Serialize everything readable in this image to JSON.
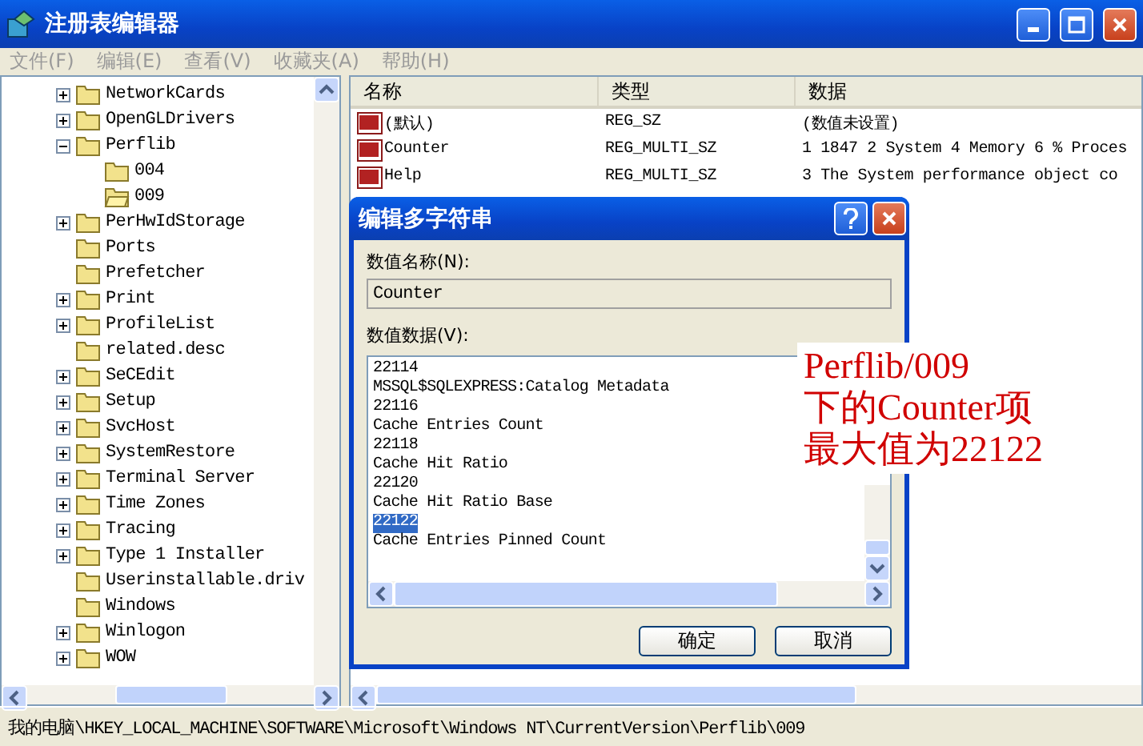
{
  "window": {
    "title": "注册表编辑器"
  },
  "menu": [
    "文件(F)",
    "编辑(E)",
    "查看(V)",
    "收藏夹(A)",
    "帮助(H)"
  ],
  "tree": [
    {
      "label": "NetworkCards",
      "expandable": true,
      "expanded": false,
      "selected": false
    },
    {
      "label": "OpenGLDrivers",
      "expandable": true,
      "expanded": false,
      "selected": false
    },
    {
      "label": "Perflib",
      "expandable": true,
      "expanded": true,
      "selected": false,
      "children": [
        {
          "label": "004",
          "expandable": false,
          "selected": false
        },
        {
          "label": "009",
          "expandable": false,
          "selected": true
        }
      ]
    },
    {
      "label": "PerHwIdStorage",
      "expandable": true,
      "expanded": false,
      "selected": false
    },
    {
      "label": "Ports",
      "expandable": false,
      "selected": false
    },
    {
      "label": "Prefetcher",
      "expandable": false,
      "selected": false
    },
    {
      "label": "Print",
      "expandable": true,
      "expanded": false,
      "selected": false
    },
    {
      "label": "ProfileList",
      "expandable": true,
      "expanded": false,
      "selected": false
    },
    {
      "label": "related.desc",
      "expandable": false,
      "selected": false
    },
    {
      "label": "SeCEdit",
      "expandable": true,
      "expanded": false,
      "selected": false
    },
    {
      "label": "Setup",
      "expandable": true,
      "expanded": false,
      "selected": false
    },
    {
      "label": "SvcHost",
      "expandable": true,
      "expanded": false,
      "selected": false
    },
    {
      "label": "SystemRestore",
      "expandable": true,
      "expanded": false,
      "selected": false
    },
    {
      "label": "Terminal Server",
      "expandable": true,
      "expanded": false,
      "selected": false
    },
    {
      "label": "Time Zones",
      "expandable": true,
      "expanded": false,
      "selected": false
    },
    {
      "label": "Tracing",
      "expandable": true,
      "expanded": false,
      "selected": false
    },
    {
      "label": "Type 1 Installer",
      "expandable": true,
      "expanded": false,
      "selected": false
    },
    {
      "label": "Userinstallable.driv",
      "expandable": false,
      "selected": false
    },
    {
      "label": "Windows",
      "expandable": false,
      "selected": false
    },
    {
      "label": "Winlogon",
      "expandable": true,
      "expanded": false,
      "selected": false
    },
    {
      "label": "WOW",
      "expandable": true,
      "expanded": false,
      "selected": false
    }
  ],
  "table": {
    "columns": [
      "名称",
      "类型",
      "数据"
    ],
    "rows": [
      {
        "name": "(默认)",
        "type": "REG_SZ",
        "data": "(数值未设置)"
      },
      {
        "name": "Counter",
        "type": "REG_MULTI_SZ",
        "data": "1 1847 2 System 4 Memory 6 % Proces"
      },
      {
        "name": "Help",
        "type": "REG_MULTI_SZ",
        "data": "3 The System performance object co"
      }
    ]
  },
  "dialog": {
    "title": "编辑多字符串",
    "name_label": "数值名称(N):",
    "name_value": "Counter",
    "data_label": "数值数据(V):",
    "lines": [
      {
        "text": "22114",
        "selected": false
      },
      {
        "text": "MSSQL$SQLEXPRESS:Catalog Metadata",
        "selected": false
      },
      {
        "text": "22116",
        "selected": false
      },
      {
        "text": "Cache Entries Count",
        "selected": false
      },
      {
        "text": "22118",
        "selected": false
      },
      {
        "text": "Cache Hit Ratio",
        "selected": false
      },
      {
        "text": "22120",
        "selected": false
      },
      {
        "text": "Cache Hit Ratio Base",
        "selected": false
      },
      {
        "text": "22122",
        "selected": true
      },
      {
        "text": "Cache Entries Pinned Count",
        "selected": false
      }
    ],
    "buttons": [
      "确定",
      "取消"
    ]
  },
  "annotation": {
    "lines": [
      "Perflib/009",
      "下的Counter项",
      "最大值为22122"
    ]
  },
  "status_bar": "我的电脑\\HKEY_LOCAL_MACHINE\\SOFTWARE\\Microsoft\\Windows NT\\CurrentVersion\\Perflib\\009"
}
